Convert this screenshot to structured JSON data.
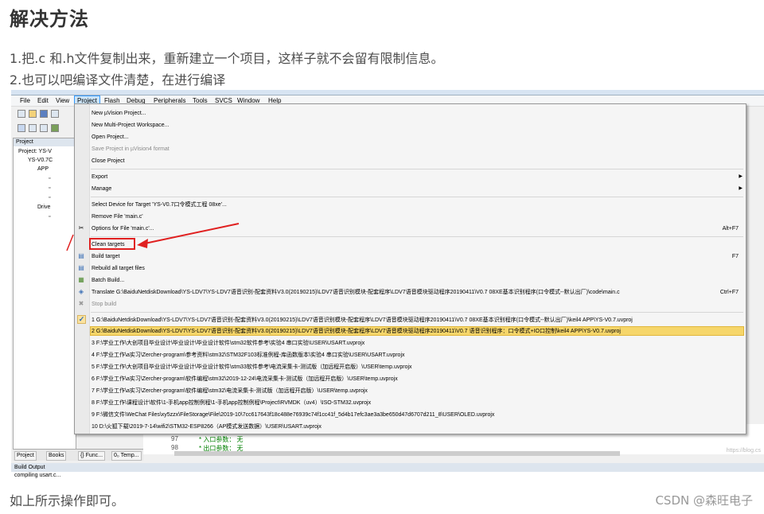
{
  "article": {
    "heading": "解决方法",
    "step1": "1.把.c 和.h文件复制出来，重新建立一个项目，这样子就不会留有限制信息。",
    "step2": "2.也可以吧编译文件清楚，在进行编译",
    "footer": "如上所示操作即可。",
    "brand": "CSDN @森旺电子"
  },
  "ide": {
    "menubar": [
      "File",
      "Edit",
      "View",
      "Project",
      "Flash",
      "Debug",
      "Peripherals",
      "Tools",
      "SVCS",
      "Window",
      "Help"
    ],
    "active_menu": "Project",
    "panel_title": "Project",
    "tree": [
      "Project: YS-V",
      "YS-V0.7C",
      "APP",
      "Drive"
    ],
    "bottom_tabs": [
      "Project",
      "Books",
      "{} Func...",
      "0₀ Temp..."
    ],
    "build_output_title": "Build Output",
    "build_output_text": "compiling usart.c...",
    "line_numbers": [
      "97",
      "98"
    ],
    "code_lines": [
      "* 入口参数：  无",
      "* 出口参数：  无"
    ],
    "watermark": "https://blog.cs"
  },
  "menu": {
    "new_project": "New µVision Project...",
    "new_multi": "New Multi-Project Workspace...",
    "open_project": "Open Project...",
    "save_project_v4": "Save Project in µVision4 format",
    "close_project": "Close Project",
    "export": "Export",
    "manage": "Manage",
    "select_device": "Select Device for Target 'YS-V0.7口令模式工程 08xe'...",
    "remove_file": "Remove File 'main.c'",
    "options_file": "Options for File 'main.c'...",
    "options_shortcut": "Alt+F7",
    "clean_targets": "Clean targets",
    "build_target": "Build target",
    "build_shortcut": "F7",
    "rebuild": "Rebuild all target files",
    "batch_build": "Batch Build...",
    "translate": "Translate G:\\BaiduNetdiskDownload\\YS-LDV7\\YS-LDV7语音识别-配套资料V3.0(20190215)\\LDV7语音识别模块-配套程序\\LDV7语音模块驱动程序20190411\\V0.7 08XE基本识别程序(口令模式--默认出厂)\\code\\main.c",
    "translate_shortcut": "Ctrl+F7",
    "stop_build": "Stop build",
    "recent": [
      "1 G:\\BaiduNetdiskDownload\\YS-LDV7\\YS-LDV7语音识别-配套资料V3.0(20190215)\\LDV7语音识别模块-配套程序\\LDV7语音模块驱动程序20190411\\V0.7 08XE基本识别程序(口令模式--默认出厂)\\keil4 APP\\YS-V0.7.uvproj",
      "2 G:\\BaiduNetdiskDownload\\YS-LDV7\\YS-LDV7语音识别-配套资料V3.0(20190215)\\LDV7语音识别模块-配套程序\\LDV7语音模块驱动程序20190411\\V0.7 语音识别程序：口令模式+IO口控制\\keil4 APP\\YS-V0.7.uvproj",
      "3 F:\\学业工作\\大创项目毕业设计\\毕业设计\\毕业设计软件\\stm32软件参考\\实验4 串口实验\\USER\\USART.uvprojx",
      "4 F:\\学业工作\\a实习\\Zercher-program\\参考资料\\stm32\\STM32F103标准例程-库函数版本\\实验4 串口实验\\USER\\USART.uvprojx",
      "5 F:\\学业工作\\大创项目毕业设计\\毕业设计\\毕业设计软件\\stm33软件参考\\电流采集卡-测试版（加远程开启版）\\USER\\temp.uvprojx",
      "6 F:\\学业工作\\a实习\\Zercher-program\\软件编程\\stm32\\2019-12-24\\电流采集卡-测试版（加远程开启版）\\USER\\temp.uvprojx",
      "7 F:\\学业工作\\a实习\\Zercher-program\\软件编程\\stm32\\电流采集卡-测试版（加远程开启版）\\USER\\temp.uvprojx",
      "8 F:\\学业工作\\课程设计\\软件\\1-手机app控制例程\\1-手机app控制例程\\Project\\RVMDK（uv4）\\ISO-STM32.uvprojx",
      "9 F:\\微信文件\\WeChat Files\\xy5zzx\\FileStorage\\File\\2019-10\\7cc617643f18c488e76939c74f1cc41f_5d4b17efc3ae3a3be650d47d6707d211_8\\USER\\OLED.uvprojx",
      "10 D:\\火狐下载\\2019-7-14\\wifi2\\STM32-ESP8266（AP模式发送数据）\\USER\\USART.uvprojx"
    ]
  }
}
